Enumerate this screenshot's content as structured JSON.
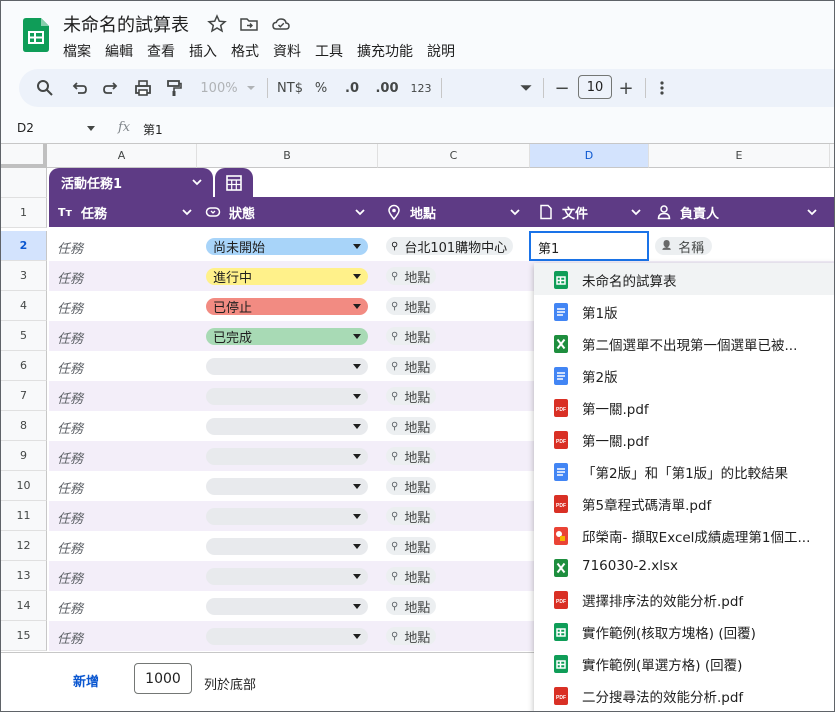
{
  "document": {
    "title": "未命名的試算表"
  },
  "menu": [
    "檔案",
    "編輯",
    "查看",
    "插入",
    "格式",
    "資料",
    "工具",
    "擴充功能",
    "說明"
  ],
  "toolbar": {
    "zoom": "100%",
    "currency": "NT$",
    "percent": "%",
    "dec_less": ".0",
    "dec_more": ".00",
    "format": "123",
    "font_size": "10",
    "minus": "−",
    "plus": "+"
  },
  "formula_bar": {
    "cell_ref": "D2",
    "fx": "fx",
    "content": "第1"
  },
  "columns": [
    "A",
    "B",
    "C",
    "D",
    "E"
  ],
  "table": {
    "tab_name": "活動任務1",
    "headers": {
      "task": "任務",
      "status": "狀態",
      "location": "地點",
      "file": "文件",
      "owner": "負責人"
    },
    "header_icons": {
      "task": "Tт"
    }
  },
  "rows": [
    {
      "num": "2",
      "task": "任務",
      "status": "尚未開始",
      "status_color": "#a8d4f9",
      "location": "台北101購物中心",
      "file": "第1",
      "owner": "名稱"
    },
    {
      "num": "3",
      "task": "任務",
      "status": "進行中",
      "status_color": "#fff18a",
      "location": "地點"
    },
    {
      "num": "4",
      "task": "任務",
      "status": "已停止",
      "status_color": "#f28b82",
      "location": "地點"
    },
    {
      "num": "5",
      "task": "任務",
      "status": "已完成",
      "status_color": "#a8dab5",
      "location": "地點"
    },
    {
      "num": "6",
      "task": "任務",
      "status": "",
      "status_color": "#e8eaed",
      "location": "地點"
    },
    {
      "num": "7",
      "task": "任務",
      "status": "",
      "status_color": "#e8eaed",
      "location": "地點"
    },
    {
      "num": "8",
      "task": "任務",
      "status": "",
      "status_color": "#e8eaed",
      "location": "地點"
    },
    {
      "num": "9",
      "task": "任務",
      "status": "",
      "status_color": "#e8eaed",
      "location": "地點"
    },
    {
      "num": "10",
      "task": "任務",
      "status": "",
      "status_color": "#e8eaed",
      "location": "地點"
    },
    {
      "num": "11",
      "task": "任務",
      "status": "",
      "status_color": "#e8eaed",
      "location": "地點"
    },
    {
      "num": "12",
      "task": "任務",
      "status": "",
      "status_color": "#e8eaed",
      "location": "地點"
    },
    {
      "num": "13",
      "task": "任務",
      "status": "",
      "status_color": "#e8eaed",
      "location": "地點"
    },
    {
      "num": "14",
      "task": "任務",
      "status": "",
      "status_color": "#e8eaed",
      "location": "地點"
    },
    {
      "num": "15",
      "task": "任務",
      "status": "",
      "status_color": "#e8eaed",
      "location": "地點"
    }
  ],
  "row1_num": "1",
  "footer": {
    "add_label": "新增",
    "count": "1000",
    "suffix": "列於底部"
  },
  "suggestions": [
    {
      "type": "sheets",
      "label": "未命名的試算表"
    },
    {
      "type": "docs",
      "label": "第1版"
    },
    {
      "type": "excel",
      "label": "第二個選單不出現第一個選單已被..."
    },
    {
      "type": "docs",
      "label": "第2版"
    },
    {
      "type": "pdf",
      "label": "第一關.pdf"
    },
    {
      "type": "pdf",
      "label": "第一關.pdf"
    },
    {
      "type": "docs",
      "label": "「第2版」和「第1版」的比較結果"
    },
    {
      "type": "pdf",
      "label": "第5章程式碼清單.pdf"
    },
    {
      "type": "slides",
      "label": "邱榮南- 擷取Excel成績處理第1個工..."
    },
    {
      "type": "excel",
      "label": "716030-2.xlsx"
    },
    {
      "type": "pdf",
      "label": "選擇排序法的效能分析.pdf"
    },
    {
      "type": "sheets",
      "label": "實作範例(核取方塊格) (回覆)"
    },
    {
      "type": "sheets",
      "label": "實作範例(單選方格) (回覆)"
    },
    {
      "type": "pdf",
      "label": "二分搜尋法的效能分析.pdf"
    }
  ],
  "colors": {
    "table_header": "#5e3b85",
    "accent": "#1a73e8",
    "row_alt": "#f3eef9"
  }
}
